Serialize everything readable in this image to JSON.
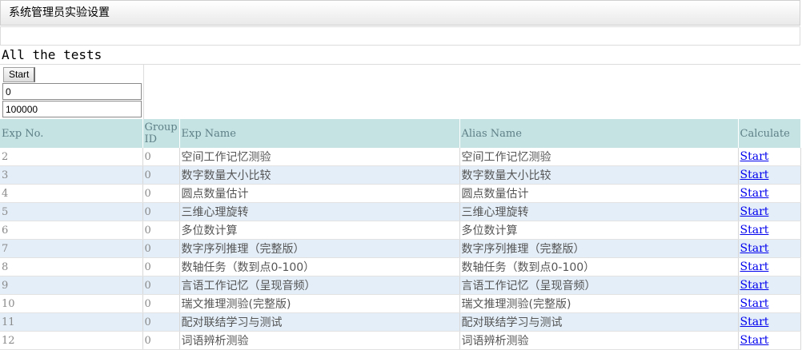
{
  "header": {
    "title": "系统管理员实验设置"
  },
  "section": {
    "title": "All the tests"
  },
  "controls": {
    "start_label": "Start",
    "from_value": "0",
    "to_value": "100000"
  },
  "table": {
    "headers": {
      "exp_no": "Exp No.",
      "group_id": "Group ID",
      "exp_name": "Exp Name",
      "alias": "Alias Name",
      "calc": "Calculate"
    },
    "rows": [
      {
        "no": "2",
        "group": "0",
        "name": "空间工作记忆测验",
        "alias": "空间工作记忆测验",
        "action": "Start"
      },
      {
        "no": "3",
        "group": "0",
        "name": "数字数量大小比较",
        "alias": "数字数量大小比较",
        "action": "Start"
      },
      {
        "no": "4",
        "group": "0",
        "name": "圆点数量估计",
        "alias": "圆点数量估计",
        "action": "Start"
      },
      {
        "no": "5",
        "group": "0",
        "name": "三维心理旋转",
        "alias": "三维心理旋转",
        "action": "Start"
      },
      {
        "no": "6",
        "group": "0",
        "name": "多位数计算",
        "alias": "多位数计算",
        "action": "Start"
      },
      {
        "no": "7",
        "group": "0",
        "name": "数字序列推理（完整版）",
        "alias": "数字序列推理（完整版）",
        "action": "Start"
      },
      {
        "no": "8",
        "group": "0",
        "name": "数轴任务（数到点0-100）",
        "alias": "数轴任务（数到点0-100）",
        "action": "Start"
      },
      {
        "no": "9",
        "group": "0",
        "name": "言语工作记忆（呈现音频）",
        "alias": "言语工作记忆（呈现音频）",
        "action": "Start"
      },
      {
        "no": "10",
        "group": "0",
        "name": "瑞文推理测验(完整版)",
        "alias": "瑞文推理测验(完整版)",
        "action": "Start"
      },
      {
        "no": "11",
        "group": "0",
        "name": "配对联结学习与测试",
        "alias": "配对联结学习与测试",
        "action": "Start"
      },
      {
        "no": "12",
        "group": "0",
        "name": "词语辨析测验",
        "alias": "词语辨析测验",
        "action": "Start"
      }
    ]
  }
}
